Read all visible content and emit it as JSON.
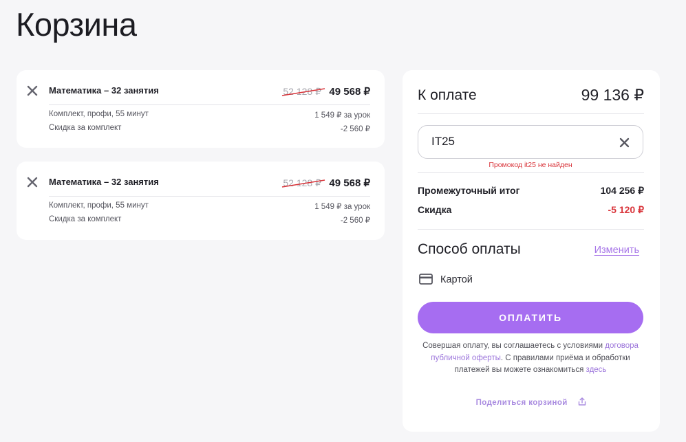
{
  "page": {
    "title": "Корзина"
  },
  "cart": {
    "items": [
      {
        "name": "Математика – 32 занятия",
        "old_price": "52 128 ₽",
        "price": "49 568 ₽",
        "details": [
          {
            "label": "Комплект, профи, 55 минут",
            "value": "1 549 ₽ за урок"
          },
          {
            "label": "Скидка за комплект",
            "value": "-2 560 ₽"
          }
        ]
      },
      {
        "name": "Математика – 32 занятия",
        "old_price": "52 128 ₽",
        "price": "49 568 ₽",
        "details": [
          {
            "label": "Комплект, профи, 55 минут",
            "value": "1 549 ₽ за урок"
          },
          {
            "label": "Скидка за комплект",
            "value": "-2 560 ₽"
          }
        ]
      }
    ]
  },
  "summary": {
    "total_label": "К оплате",
    "total_value": "99 136 ₽",
    "promo": {
      "value": "IT25",
      "error": "Промокод it25 не найден"
    },
    "subtotal_label": "Промежуточный итог",
    "subtotal_value": "104 256 ₽",
    "discount_label": "Скидка",
    "discount_value": "-5 120 ₽",
    "payment_method_title": "Способ оплаты",
    "payment_method_change": "Изменить",
    "payment_method_value": "Картой",
    "pay_button": "ОПЛАТИТЬ",
    "legal": {
      "text1": "Совершая оплату, вы соглашаетесь с условиями",
      "link1": "договора публичной оферты",
      "text2": ". С правилами приёма и обработки платежей вы можете ознакомиться",
      "link2": "здесь"
    },
    "share_label": "Поделиться корзиной"
  },
  "colors": {
    "accent": "#a66df1",
    "error": "#d9353b",
    "link": "#9c75db",
    "background": "#f6f6f8"
  },
  "icons": {
    "remove": "close-icon",
    "promo_clear": "close-icon",
    "payment": "credit-card-icon",
    "share": "share-icon"
  }
}
